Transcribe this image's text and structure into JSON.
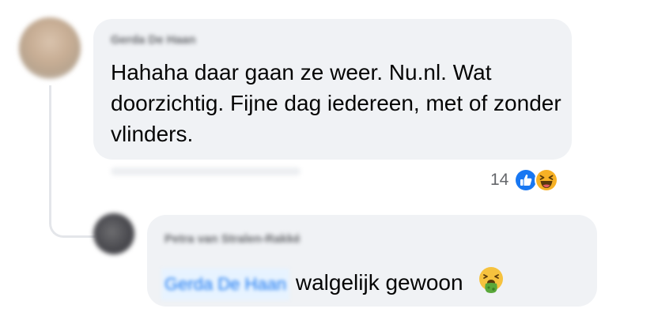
{
  "comments": [
    {
      "author": "Gerda De Haan",
      "text": "Hahaha daar gaan ze weer. Nu.nl. Wat doorzichtig. Fijne dag iedereen, met of zonder vlinders.",
      "reactions": {
        "count": "14",
        "icons": [
          "like-icon",
          "haha-icon"
        ]
      }
    }
  ],
  "reply": {
    "author": "Petra van Stralen-Rakké",
    "mention": "Gerda De Haan",
    "text": "walgelijk gewoon",
    "emoji": "nauseated-face-icon"
  },
  "colors": {
    "bubble": "#f0f2f5",
    "text": "#050505",
    "secondary": "#65676b",
    "like": "#1877f2",
    "haha": "#f7b125"
  }
}
